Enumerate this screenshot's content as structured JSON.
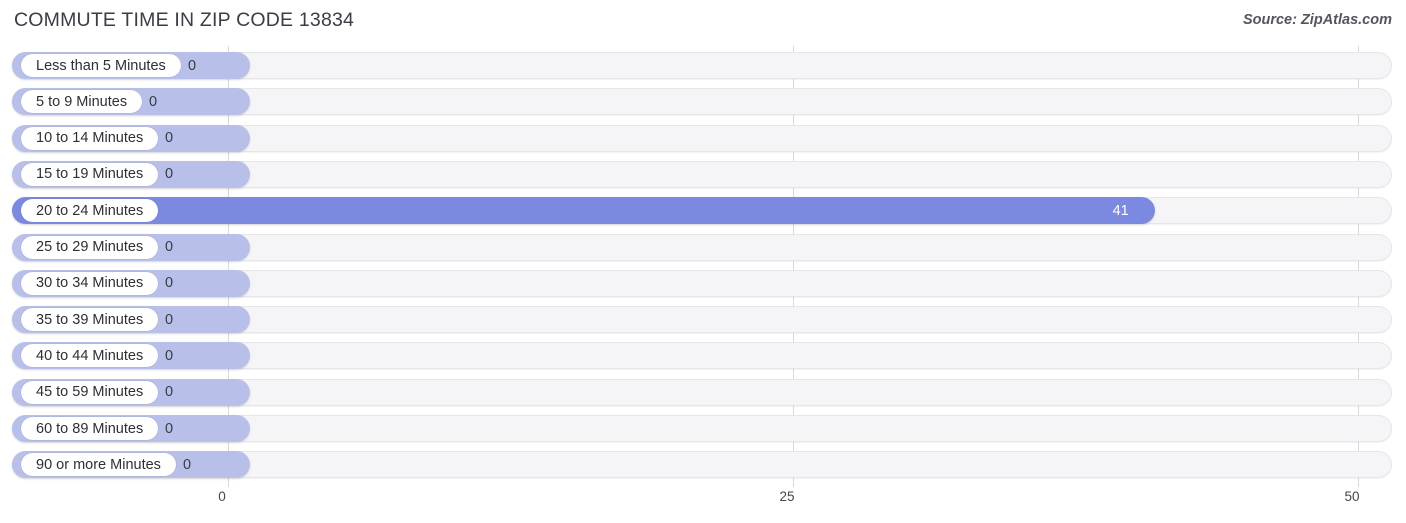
{
  "header": {
    "title": "COMMUTE TIME IN ZIP CODE 13834",
    "source": "Source: ZipAtlas.com"
  },
  "colors": {
    "bar_low": "#b8c0ea",
    "bar_high": "#7b8ae0",
    "track": "#f5f5f7",
    "gridline": "#d9d9dd",
    "title_text": "#3c3c46"
  },
  "axis": {
    "ticks": [
      "0",
      "25",
      "50"
    ],
    "min": 0,
    "max": 50
  },
  "chart_data": {
    "type": "bar",
    "orientation": "horizontal",
    "title": "COMMUTE TIME IN ZIP CODE 13834",
    "xlabel": "",
    "ylabel": "",
    "xlim": [
      0,
      50
    ],
    "grid": true,
    "legend": "none",
    "source": "Source: ZipAtlas.com",
    "categories": [
      "Less than 5 Minutes",
      "5 to 9 Minutes",
      "10 to 14 Minutes",
      "15 to 19 Minutes",
      "20 to 24 Minutes",
      "25 to 29 Minutes",
      "30 to 34 Minutes",
      "35 to 39 Minutes",
      "40 to 44 Minutes",
      "45 to 59 Minutes",
      "60 to 89 Minutes",
      "90 or more Minutes"
    ],
    "values": [
      0,
      0,
      0,
      0,
      41,
      0,
      0,
      0,
      0,
      0,
      0,
      0
    ],
    "value_labels": [
      "0",
      "0",
      "0",
      "0",
      "41",
      "0",
      "0",
      "0",
      "0",
      "0",
      "0",
      "0"
    ],
    "highlight_index": 4
  },
  "rows": [
    {
      "label": "Less than 5 Minutes",
      "value": 0,
      "value_label": "0",
      "highlight": false
    },
    {
      "label": "5 to 9 Minutes",
      "value": 0,
      "value_label": "0",
      "highlight": false
    },
    {
      "label": "10 to 14 Minutes",
      "value": 0,
      "value_label": "0",
      "highlight": false
    },
    {
      "label": "15 to 19 Minutes",
      "value": 0,
      "value_label": "0",
      "highlight": false
    },
    {
      "label": "20 to 24 Minutes",
      "value": 41,
      "value_label": "41",
      "highlight": true
    },
    {
      "label": "25 to 29 Minutes",
      "value": 0,
      "value_label": "0",
      "highlight": false
    },
    {
      "label": "30 to 34 Minutes",
      "value": 0,
      "value_label": "0",
      "highlight": false
    },
    {
      "label": "35 to 39 Minutes",
      "value": 0,
      "value_label": "0",
      "highlight": false
    },
    {
      "label": "40 to 44 Minutes",
      "value": 0,
      "value_label": "0",
      "highlight": false
    },
    {
      "label": "45 to 59 Minutes",
      "value": 0,
      "value_label": "0",
      "highlight": false
    },
    {
      "label": "60 to 89 Minutes",
      "value": 0,
      "value_label": "0",
      "highlight": false
    },
    {
      "label": "90 or more Minutes",
      "value": 0,
      "value_label": "0",
      "highlight": false
    }
  ]
}
